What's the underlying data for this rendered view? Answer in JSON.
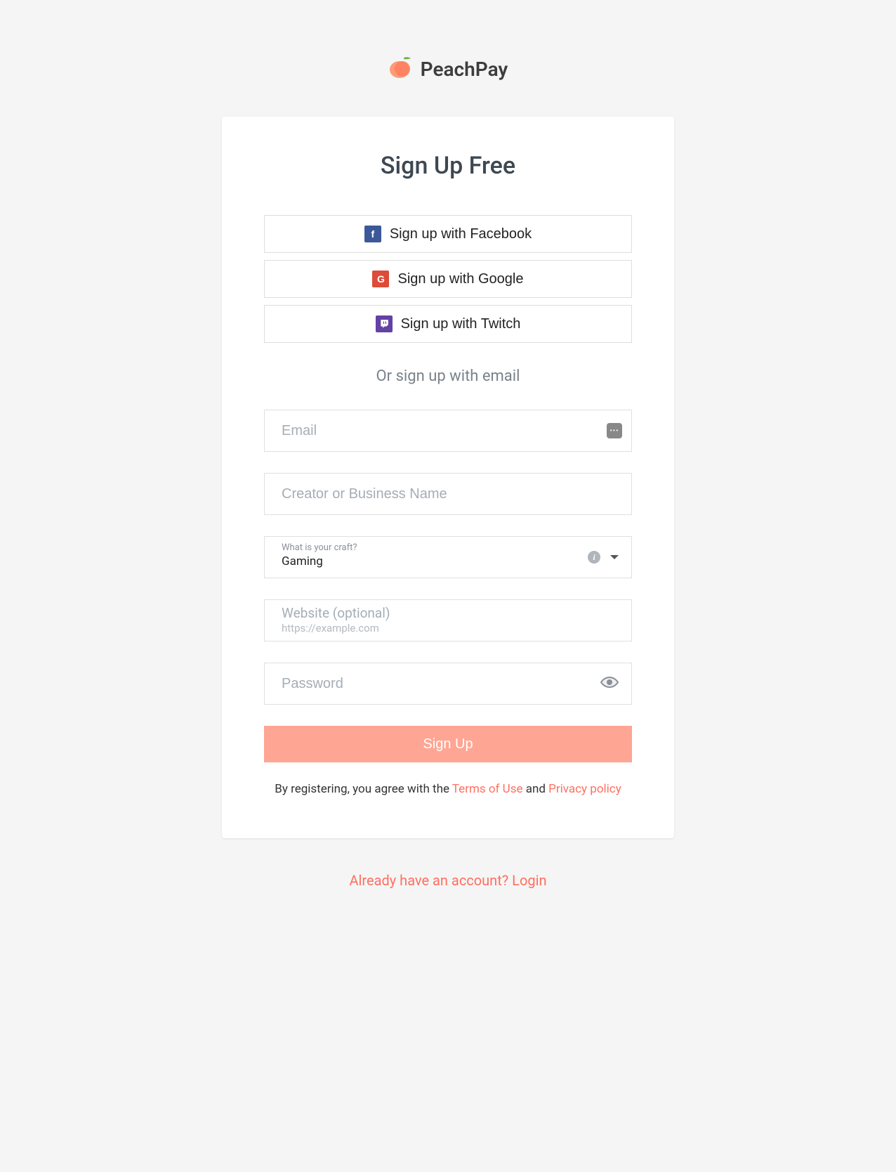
{
  "brand": {
    "name": "PeachPay"
  },
  "form": {
    "title": "Sign Up Free",
    "social": {
      "facebook": "Sign up with Facebook",
      "google": "Sign up with Google",
      "twitch": "Sign up with Twitch"
    },
    "divider": "Or sign up with email",
    "email_placeholder": "Email",
    "name_placeholder": "Creator or Business Name",
    "craft": {
      "label": "What is your craft?",
      "value": "Gaming"
    },
    "website": {
      "label": "Website (optional)",
      "placeholder_sub": "https://example.com"
    },
    "password_placeholder": "Password",
    "submit": "Sign Up",
    "terms": {
      "prefix": "By registering, you agree with the ",
      "tou": "Terms of Use",
      "and": " and ",
      "privacy": "Privacy policy"
    }
  },
  "footer": {
    "login_prompt": "Already have an account? Login"
  }
}
